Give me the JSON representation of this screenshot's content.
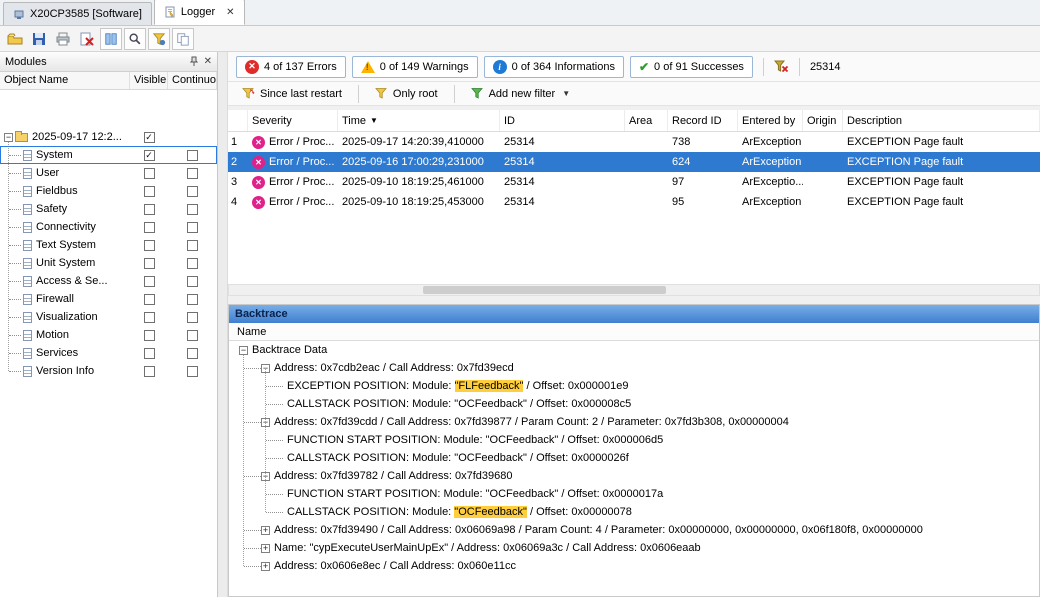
{
  "window": {
    "tabs": [
      {
        "label": "X20CP3585 [Software]"
      },
      {
        "label": "Logger"
      }
    ]
  },
  "toolbar": {
    "icons": [
      "open",
      "save",
      "print",
      "clear-logger",
      "columns",
      "search",
      "filter-settings",
      "copy"
    ]
  },
  "modules_panel": {
    "title": "Modules",
    "columns": [
      "Object Name",
      "Visible",
      "Continuou"
    ],
    "root": {
      "label": "2025-09-17 12:2...",
      "visible": true
    },
    "items": [
      {
        "label": "System",
        "visible": true,
        "continuous": false,
        "selected": true
      },
      {
        "label": "User",
        "visible": false,
        "continuous": false
      },
      {
        "label": "Fieldbus",
        "visible": false,
        "continuous": false
      },
      {
        "label": "Safety",
        "visible": false,
        "continuous": false
      },
      {
        "label": "Connectivity",
        "visible": false,
        "continuous": false
      },
      {
        "label": "Text System",
        "visible": false,
        "continuous": false
      },
      {
        "label": "Unit System",
        "visible": false,
        "continuous": false
      },
      {
        "label": "Access & Se...",
        "visible": false,
        "continuous": false
      },
      {
        "label": "Firewall",
        "visible": false,
        "continuous": false
      },
      {
        "label": "Visualization",
        "visible": false,
        "continuous": false
      },
      {
        "label": "Motion",
        "visible": false,
        "continuous": false
      },
      {
        "label": "Services",
        "visible": false,
        "continuous": false
      },
      {
        "label": "Version Info",
        "visible": false,
        "continuous": false
      }
    ]
  },
  "filter_bar": {
    "errors": "4 of 137 Errors",
    "warnings": "0 of 149 Warnings",
    "informations": "0 of 364 Informations",
    "successes": "0 of 91 Successes",
    "search_value": "25314"
  },
  "filter_bar2": {
    "since_last_restart": "Since last restart",
    "only_root": "Only root",
    "add_new_filter": "Add new filter"
  },
  "log_table": {
    "columns": [
      "Severity",
      "Time",
      "ID",
      "Area",
      "Record ID",
      "Entered by",
      "Origin",
      "Description"
    ],
    "rows": [
      {
        "num": "1",
        "severity": "Error / Proc...",
        "time": "2025-09-17 14:20:39,410000",
        "id": "25314",
        "area": "",
        "record_id": "738",
        "entered_by": "ArException",
        "origin": "",
        "description": "EXCEPTION Page fault",
        "selected": false
      },
      {
        "num": "2",
        "severity": "Error / Proc...",
        "time": "2025-09-16 17:00:29,231000",
        "id": "25314",
        "area": "",
        "record_id": "624",
        "entered_by": "ArException",
        "origin": "",
        "description": "EXCEPTION Page fault",
        "selected": true
      },
      {
        "num": "3",
        "severity": "Error / Proc...",
        "time": "2025-09-10 18:19:25,461000",
        "id": "25314",
        "area": "",
        "record_id": "97",
        "entered_by": "ArExceptio...",
        "origin": "",
        "description": "EXCEPTION Page fault",
        "selected": false
      },
      {
        "num": "4",
        "severity": "Error / Proc...",
        "time": "2025-09-10 18:19:25,453000",
        "id": "25314",
        "area": "",
        "record_id": "95",
        "entered_by": "ArException",
        "origin": "",
        "description": "EXCEPTION Page fault",
        "selected": false
      }
    ]
  },
  "backtrace": {
    "title": "Backtrace",
    "column": "Name",
    "nodes": [
      {
        "level": 0,
        "expander": "minus",
        "segments": [
          {
            "text": "Backtrace Data"
          }
        ]
      },
      {
        "level": 1,
        "expander": "minus",
        "segments": [
          {
            "text": "Address: 0x7cdb2eac / Call Address: 0x7fd39ecd"
          }
        ]
      },
      {
        "level": 2,
        "expander": "none",
        "segments": [
          {
            "text": "EXCEPTION POSITION: Module: "
          },
          {
            "text": "\"FLFeedback\"",
            "highlight": true
          },
          {
            "text": " / Offset: 0x000001e9"
          }
        ]
      },
      {
        "level": 2,
        "expander": "none",
        "segments": [
          {
            "text": "CALLSTACK POSITION: Module: \"OCFeedback\" / Offset: 0x000008c5"
          }
        ]
      },
      {
        "level": 1,
        "expander": "minus",
        "segments": [
          {
            "text": "Address: 0x7fd39cdd / Call Address: 0x7fd39877 / Param Count: 2 / Parameter: 0x7fd3b308, 0x00000004"
          }
        ]
      },
      {
        "level": 2,
        "expander": "none",
        "segments": [
          {
            "text": "FUNCTION START POSITION: Module: \"OCFeedback\" / Offset: 0x000006d5"
          }
        ]
      },
      {
        "level": 2,
        "expander": "none",
        "segments": [
          {
            "text": "CALLSTACK POSITION: Module: \"OCFeedback\" / Offset: 0x0000026f"
          }
        ]
      },
      {
        "level": 1,
        "expander": "minus",
        "segments": [
          {
            "text": "Address: 0x7fd39782 / Call Address: 0x7fd39680"
          }
        ]
      },
      {
        "level": 2,
        "expander": "none",
        "segments": [
          {
            "text": "FUNCTION START POSITION: Module: \"OCFeedback\" / Offset: 0x0000017a"
          }
        ]
      },
      {
        "level": 2,
        "expander": "none",
        "segments": [
          {
            "text": "CALLSTACK POSITION: Module: "
          },
          {
            "text": "\"OCFeedback\"",
            "highlight": true
          },
          {
            "text": " / Offset: 0x00000078"
          }
        ]
      },
      {
        "level": 1,
        "expander": "plus",
        "segments": [
          {
            "text": "Address: 0x7fd39490 / Call Address: 0x06069a98 / Param Count: 4 / Parameter: 0x00000000, 0x00000000, 0x06f180f8, 0x00000000"
          }
        ]
      },
      {
        "level": 1,
        "expander": "plus",
        "segments": [
          {
            "text": "Name: \"cypExecuteUserMainUpEx\" / Address: 0x06069a3c / Call Address: 0x0606eaab"
          }
        ]
      },
      {
        "level": 1,
        "expander": "plus",
        "segments": [
          {
            "text": "Address: 0x0606e8ec / Call Address: 0x060e11cc"
          }
        ]
      }
    ]
  }
}
